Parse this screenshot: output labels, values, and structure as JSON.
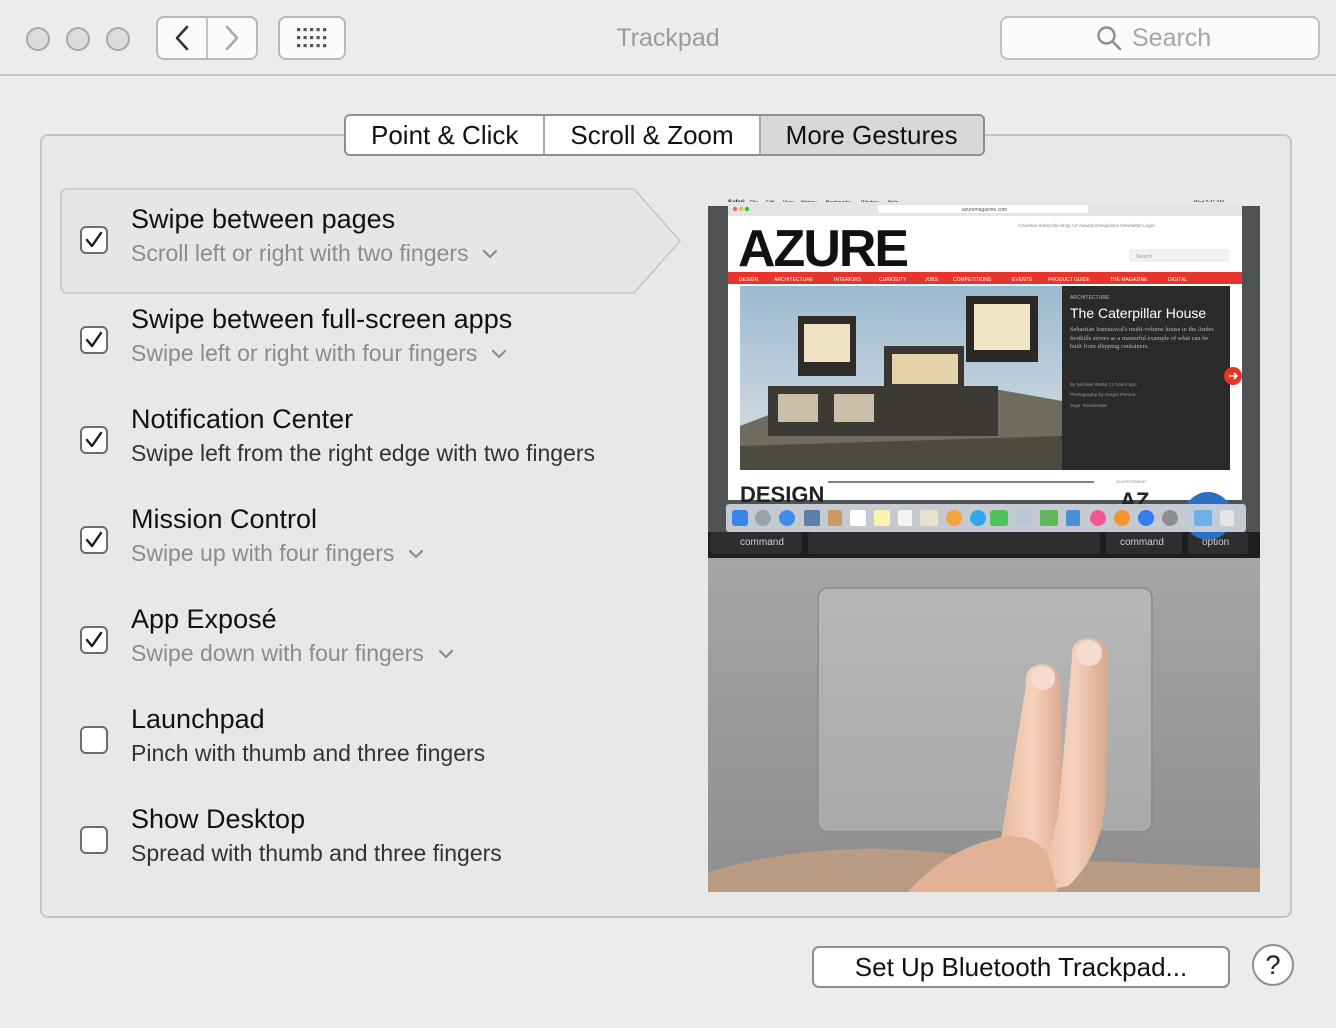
{
  "window": {
    "title": "Trackpad"
  },
  "search": {
    "placeholder": "Search"
  },
  "tabs": [
    {
      "label": "Point & Click",
      "selected": false
    },
    {
      "label": "Scroll & Zoom",
      "selected": false
    },
    {
      "label": "More Gestures",
      "selected": true
    }
  ],
  "gestures": [
    {
      "title": "Swipe between pages",
      "subtitle": "Scroll left or right with two fingers",
      "checked": true,
      "has_menu": true,
      "selected": true
    },
    {
      "title": "Swipe between full-screen apps",
      "subtitle": "Swipe left or right with four fingers",
      "checked": true,
      "has_menu": true
    },
    {
      "title": "Notification Center",
      "subtitle": "Swipe left from the right edge with two fingers",
      "checked": true,
      "has_menu": false
    },
    {
      "title": "Mission Control",
      "subtitle": "Swipe up with four fingers",
      "checked": true,
      "has_menu": true
    },
    {
      "title": "App Exposé",
      "subtitle": "Swipe down with four fingers",
      "checked": true,
      "has_menu": true
    },
    {
      "title": "Launchpad",
      "subtitle": "Pinch with thumb and three fingers",
      "checked": false,
      "has_menu": false
    },
    {
      "title": "Show Desktop",
      "subtitle": "Spread with thumb and three fingers",
      "checked": false,
      "has_menu": false
    }
  ],
  "preview": {
    "menubar": {
      "app": "Safari",
      "items": [
        "File",
        "Edit",
        "View",
        "History",
        "Bookmarks",
        "Window",
        "Help"
      ],
      "clock": "Wed 9:41 AM"
    },
    "url": "azuremagazine.com",
    "site_links": "Advertise   Subscribe   Shop   AZ Awards   Designlines   Newsletter   Login",
    "site_search_placeholder": "Search",
    "logo": "AZURE",
    "nav": [
      "DESIGN",
      "ARCHITECTURE",
      "INTERIORS",
      "CURIOSITY",
      "JOBS",
      "COMPETITIONS",
      "EVENTS",
      "PRODUCT GUIDE",
      "THE MAGAZINE",
      "DIGITAL"
    ],
    "article": {
      "kicker": "ARCHITECTURE",
      "headline": "The Caterpillar House",
      "body": "Sebastián Irarrázaval's multi-volume house in the Andes foothills serves as a masterful example of what can be built from shipping containers.",
      "byline": "By Michael Webb | 2 hours ago",
      "photo": "Photography by Sergio Pirrone",
      "tags": "Tags: Residential"
    },
    "below_heading": "DESIGN",
    "below_right": "AZ",
    "advertisement": "ADVERTISEMENT",
    "keys": {
      "left": "command",
      "right_cmd": "command",
      "option": "option"
    }
  },
  "buttons": {
    "bluetooth": "Set Up Bluetooth Trackpad...",
    "help": "?"
  },
  "colors": {
    "accent_red": "#e8352b",
    "check": "#1a1a1a"
  }
}
